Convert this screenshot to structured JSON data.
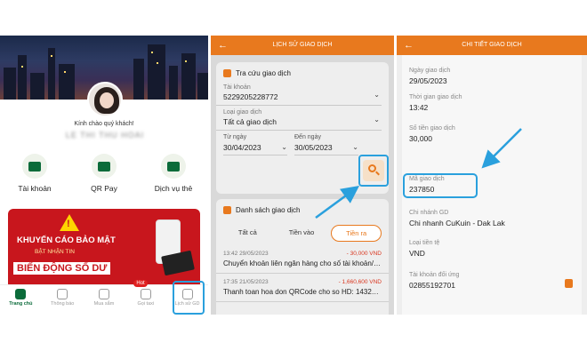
{
  "panel_home": {
    "greeting": "Kính chào quý khách!",
    "user_name": "LE THI THU HOAI",
    "quick_actions": [
      {
        "label": "Tài khoản",
        "icon": "wallet-icon"
      },
      {
        "label": "QR Pay",
        "icon": "qr-icon"
      },
      {
        "label": "Dịch vụ thẻ",
        "icon": "card-icon"
      }
    ],
    "banner": {
      "title": "KHUYẾN CÁO BẢO MẬT",
      "subtitle": "BẬT NHẬN TIN",
      "highlight": "BIẾN ĐỘNG SỐ DƯ"
    },
    "tabs": [
      {
        "label": "Trang chủ",
        "icon": "home-icon",
        "active": true
      },
      {
        "label": "Thông báo",
        "icon": "bell-icon"
      },
      {
        "label": "Mua sắm",
        "icon": "shopping-bag-icon"
      },
      {
        "label": "Gọi taxi",
        "icon": "car-icon",
        "badge": "Hot"
      },
      {
        "label": "Lịch sử GD",
        "icon": "history-icon"
      }
    ]
  },
  "panel_history": {
    "title": "LỊCH SỬ GIAO DỊCH",
    "lookup_section": "Tra cứu giao dịch",
    "account_label": "Tài khoản",
    "account_value": "5229205228772",
    "type_label": "Loại giao dịch",
    "type_value": "Tất cả giao dịch",
    "from_label": "Từ ngày",
    "from_value": "30/04/2023",
    "to_label": "Đến ngày",
    "to_value": "30/05/2023",
    "list_section": "Danh sách giao dịch",
    "filters": [
      "Tất cả",
      "Tiền vào",
      "Tiền ra"
    ],
    "active_filter": "Tiền ra",
    "transactions": [
      {
        "datetime": "13:42 29/05/2023",
        "amount": "- 30,000 VND",
        "desc": "Chuyển khoản liên ngân hàng cho số tài khoản/số t..."
      },
      {
        "datetime": "17:35 21/05/2023",
        "amount": "- 1,660,600 VND",
        "desc": "Thanh toan hoa don QRCode cho so HD: 1432121..."
      }
    ]
  },
  "panel_detail": {
    "title": "CHI TIẾT GIAO DỊCH",
    "fields": [
      {
        "label": "Ngày giao dịch",
        "value": "29/05/2023"
      },
      {
        "label": "Thời gian giao dịch",
        "value": "13:42"
      },
      {
        "label": "Số tiền giao dịch",
        "value": "30,000"
      },
      {
        "label": "Mã giao dịch",
        "value": "237850"
      },
      {
        "label": "Chi nhánh GD",
        "value": "Chi nhanh CuKuin - Dak Lak"
      },
      {
        "label": "Loại tiền tệ",
        "value": "VND"
      },
      {
        "label": "Tài khoản đối ứng",
        "value": "02855192701"
      }
    ]
  },
  "colors": {
    "brand_orange": "#e8791e",
    "brand_green": "#0b6b3a",
    "highlight_blue": "#2aa0dd"
  }
}
